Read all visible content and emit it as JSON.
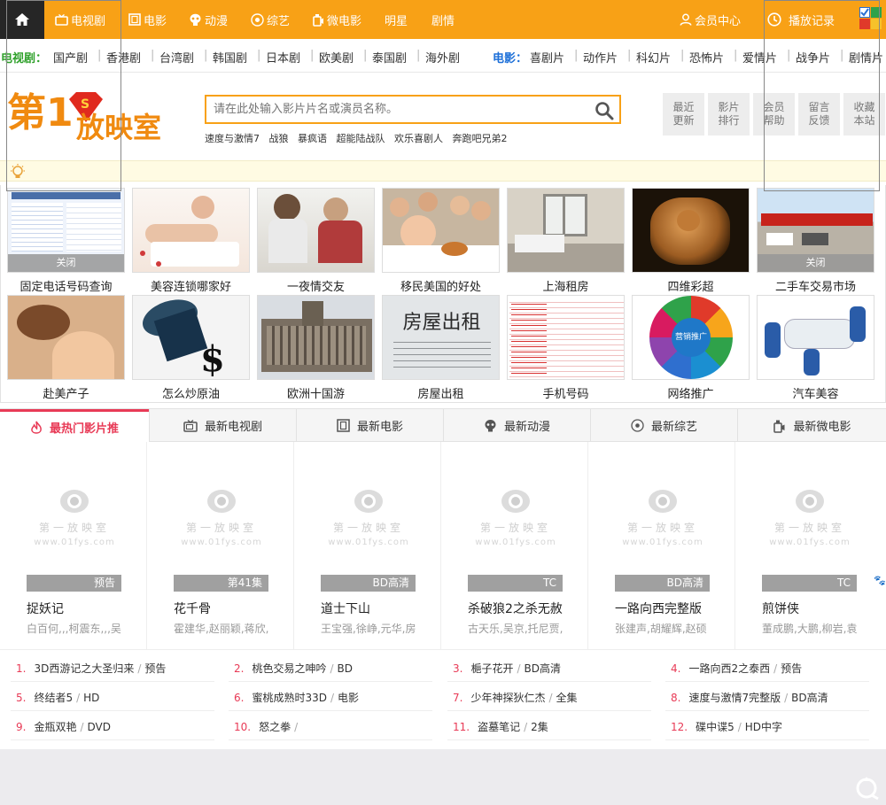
{
  "topnav": {
    "items": [
      {
        "label": "电视剧",
        "icon": "tv-icon"
      },
      {
        "label": "电影",
        "icon": "film-icon"
      },
      {
        "label": "动漫",
        "icon": "alien-icon"
      },
      {
        "label": "综艺",
        "icon": "target-icon"
      },
      {
        "label": "微电影",
        "icon": "camera-icon"
      },
      {
        "label": "明星",
        "icon": ""
      },
      {
        "label": "剧情",
        "icon": ""
      }
    ],
    "member_center": "会员中心",
    "play_history": "播放记录",
    "colors": {
      "bar": "#f8a116",
      "home_bg": "#262626"
    }
  },
  "channels": {
    "tv_label": "电视剧",
    "tv_label_color": "#2ea02a",
    "tv_links": [
      "国产剧",
      "香港剧",
      "台湾剧",
      "韩国剧",
      "日本剧",
      "欧美剧",
      "泰国剧",
      "海外剧"
    ],
    "movie_label": "电影",
    "movie_label_color": "#1c6fd8",
    "movie_links": [
      "喜剧片",
      "动作片",
      "科幻片",
      "恐怖片",
      "爱情片",
      "战争片",
      "剧情片"
    ]
  },
  "logo": {
    "text_num": "第1",
    "text_main": "放映室"
  },
  "search": {
    "placeholder": "请在此处输入影片片名或演员名称。",
    "hot_words": [
      "速度与激情7",
      "战狼",
      "暴疯语",
      "超能陆战队",
      "欢乐喜剧人",
      "奔跑吧兄弟2"
    ]
  },
  "quick_buttons": [
    "最近\n更新",
    "影片\n排行",
    "会员\n帮助",
    "留言\n反馈",
    "收藏\n本站"
  ],
  "ads_row1": [
    {
      "caption": "固定电话号码查询",
      "close": "关闭",
      "icon": "phone-database-screenshot"
    },
    {
      "caption": "美容连锁哪家好",
      "icon": "spa-massage-photo"
    },
    {
      "caption": "一夜情交友",
      "icon": "couple-photo"
    },
    {
      "caption": "移民美国的好处",
      "icon": "family-dinner-photo"
    },
    {
      "caption": "上海租房",
      "icon": "room-interior-photo"
    },
    {
      "caption": "四维彩超",
      "icon": "ultrasound-image"
    },
    {
      "caption": "二手车交易市场",
      "close": "关闭",
      "icon": "car-market-photo"
    }
  ],
  "ads_row2": [
    {
      "caption": "赴美产子",
      "icon": "pregnant-woman-photo"
    },
    {
      "caption": "怎么炒原油",
      "icon": "oil-barrel-image"
    },
    {
      "caption": "欧洲十国游",
      "icon": "europe-building-photo"
    },
    {
      "caption": "房屋出租",
      "icon": "rental-notice-photo",
      "sign_title": "房屋出租"
    },
    {
      "caption": "手机号码",
      "icon": "phone-number-table"
    },
    {
      "caption": "网络推广",
      "icon": "marketing-wheel-chart",
      "wheel_center": "营销推广"
    },
    {
      "caption": "汽车美容",
      "icon": "car-service-photo"
    }
  ],
  "tabs": [
    {
      "label": "最热门影片推",
      "icon": "flame-icon"
    },
    {
      "label": "最新电视剧",
      "icon": "tv-icon"
    },
    {
      "label": "最新电影",
      "icon": "film-icon"
    },
    {
      "label": "最新动漫",
      "icon": "alien-icon"
    },
    {
      "label": "最新综艺",
      "icon": "target-icon"
    },
    {
      "label": "最新微电影",
      "icon": "camera-icon"
    }
  ],
  "watermark": {
    "line1": "第一放映室",
    "line2": "www.01fys.com"
  },
  "cards": [
    {
      "badge": "预告",
      "title": "捉妖记",
      "actors": "白百何,,,柯震东,,,吴"
    },
    {
      "badge": "第41集",
      "title": "花千骨",
      "actors": "霍建华,赵丽颖,蒋欣,"
    },
    {
      "badge": "BD高清",
      "title": "道士下山",
      "actors": "王宝强,徐峥,元华,房"
    },
    {
      "badge": "TC",
      "title": "杀破狼2之杀无赦",
      "actors": "古天乐,吴京,托尼贾,"
    },
    {
      "badge": "BD高清",
      "title": "一路向西完整版",
      "actors": "张建声,胡耀辉,赵硕"
    },
    {
      "badge": "TC",
      "title": "煎饼侠",
      "actors": "董成鹏,大鹏,柳岩,袁"
    }
  ],
  "ranking": [
    {
      "num": "1.",
      "title": "3D西游记之大圣归来",
      "tag": "预告"
    },
    {
      "num": "2.",
      "title": "桃色交易之呻吟",
      "tag": "BD"
    },
    {
      "num": "3.",
      "title": "梔子花开",
      "tag": "BD高清"
    },
    {
      "num": "4.",
      "title": "一路向西2之泰西",
      "tag": "预告"
    },
    {
      "num": "5.",
      "title": "终结者5",
      "tag": "HD"
    },
    {
      "num": "6.",
      "title": "蜜桃成熟时33D",
      "tag": "电影"
    },
    {
      "num": "7.",
      "title": "少年神探狄仁杰",
      "tag": "全集"
    },
    {
      "num": "8.",
      "title": "速度与激情7完整版",
      "tag": "BD高清"
    },
    {
      "num": "9.",
      "title": "金瓶双艳",
      "tag": "DVD"
    },
    {
      "num": "10.",
      "title": "怒之拳",
      "tag": ""
    },
    {
      "num": "11.",
      "title": "盗墓笔记",
      "tag": "2集"
    },
    {
      "num": "12.",
      "title": "碟中谍5",
      "tag": "HD中字"
    }
  ],
  "accent_color": "#e83a56"
}
